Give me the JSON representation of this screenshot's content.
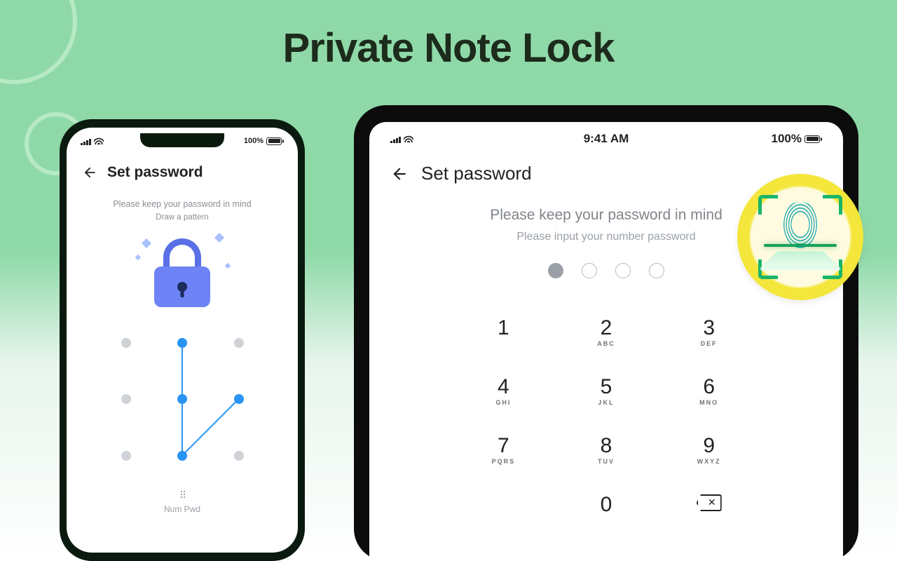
{
  "hero": {
    "title": "Private Note Lock"
  },
  "status": {
    "time": "9:41 AM",
    "battery_text": "100%"
  },
  "phone": {
    "screen_title": "Set password",
    "hint_primary": "Please keep your password in mind",
    "hint_secondary": "Draw a pattern",
    "num_pwd_label": "Num Pwd",
    "pattern": {
      "grid": 3,
      "highlighted_nodes": [
        2,
        5,
        8,
        6
      ],
      "path": [
        [
          2,
          5
        ],
        [
          5,
          8
        ],
        [
          8,
          6
        ]
      ]
    }
  },
  "tablet": {
    "screen_title": "Set password",
    "hint_primary": "Please keep your password in mind",
    "hint_secondary": "Please input your number password",
    "pin": {
      "length": 4,
      "entered": 1
    },
    "keypad": [
      {
        "digit": "1",
        "letters": ""
      },
      {
        "digit": "2",
        "letters": "ABC"
      },
      {
        "digit": "3",
        "letters": "DEF"
      },
      {
        "digit": "4",
        "letters": "GHI"
      },
      {
        "digit": "5",
        "letters": "JKL"
      },
      {
        "digit": "6",
        "letters": "MNO"
      },
      {
        "digit": "7",
        "letters": "PQRS"
      },
      {
        "digit": "8",
        "letters": "TUV"
      },
      {
        "digit": "9",
        "letters": "WXYZ"
      },
      {
        "digit": "",
        "letters": ""
      },
      {
        "digit": "0",
        "letters": ""
      },
      {
        "digit": "⌫",
        "letters": "",
        "is_backspace": true
      }
    ]
  },
  "badge": {
    "name": "fingerprint-scan"
  }
}
